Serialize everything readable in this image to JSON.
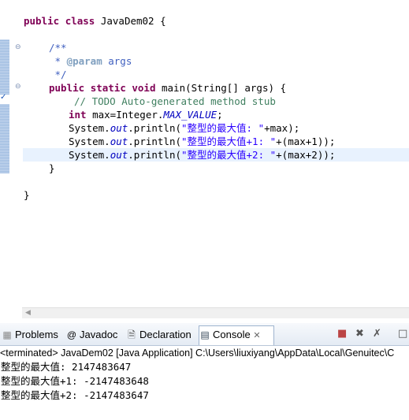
{
  "editor": {
    "lines": {
      "l1": {
        "kw1": "public",
        "kw2": "class",
        "rest": " JavaDem02 {"
      },
      "l2": {
        "text": "/**"
      },
      "l3": {
        "star": " * ",
        "tag": "@param",
        "rest": " args"
      },
      "l4": {
        "text": " */"
      },
      "l5": {
        "kw1": "public",
        "kw2": "static",
        "kw3": "void",
        "rest": " main(String[] args) {"
      },
      "l6": {
        "text": "// TODO Auto-generated method stub"
      },
      "l7": {
        "kw": "int",
        "a": " max=Integer.",
        "field": "MAX_VALUE",
        "b": ";"
      },
      "l8": {
        "a": "System.",
        "out": "out",
        "b": ".println(",
        "str": "\"整型的最大值: \"",
        "c": "+max);"
      },
      "l9": {
        "a": "System.",
        "out": "out",
        "b": ".println(",
        "str": "\"整型的最大值+1: \"",
        "c": "+(max+1));"
      },
      "l10": {
        "a": "System.",
        "out": "out",
        "b": ".println(",
        "str": "\"整型的最大值+2: \"",
        "c": "+(max+2));"
      },
      "l11": {
        "text": "}"
      },
      "l12": {
        "text": "}"
      }
    }
  },
  "panel": {
    "tabs": [
      "Problems",
      "Javadoc",
      "Declaration",
      "Console"
    ],
    "close_glyph": "✕",
    "status": "<terminated> JavaDem02 [Java Application] C:\\Users\\liuxiyang\\AppData\\Local\\Genuitec\\C",
    "output": [
      "整型的最大值: 2147483647",
      "整型的最大值+1: -2147483648",
      "整型的最大值+2: -2147483647"
    ]
  }
}
